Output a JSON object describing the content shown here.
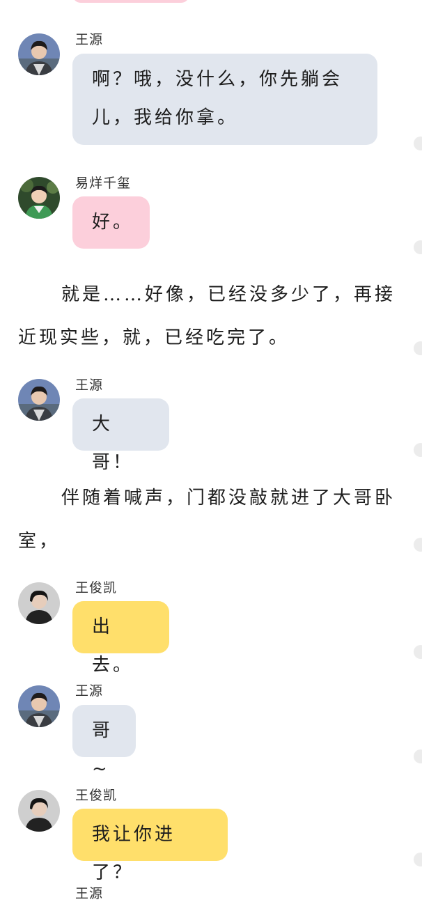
{
  "messages": [
    {
      "name": "王源",
      "text": "啊？哦，没什么，你先躺会儿，我给你拿。"
    },
    {
      "name": "易烊千玺",
      "text": "好。"
    },
    {
      "name": "王源",
      "text": "大哥！"
    },
    {
      "name": "王俊凯",
      "text": "出去。"
    },
    {
      "name": "王源",
      "text": "哥~"
    },
    {
      "name": "王俊凯",
      "text": "我让你进了？"
    }
  ],
  "narration": [
    "就是……好像，已经没多少了，再接近现实些，就，已经吃完了。",
    "伴随着喊声，门都没敲就进了大哥卧室，"
  ],
  "bottom_partial_name": "王源",
  "colors": {
    "wangyuan_bubble": "#e1e6ee",
    "yiyang_bubble": "#fccfdb",
    "wangjunkai_bubble": "#ffdf6b"
  }
}
